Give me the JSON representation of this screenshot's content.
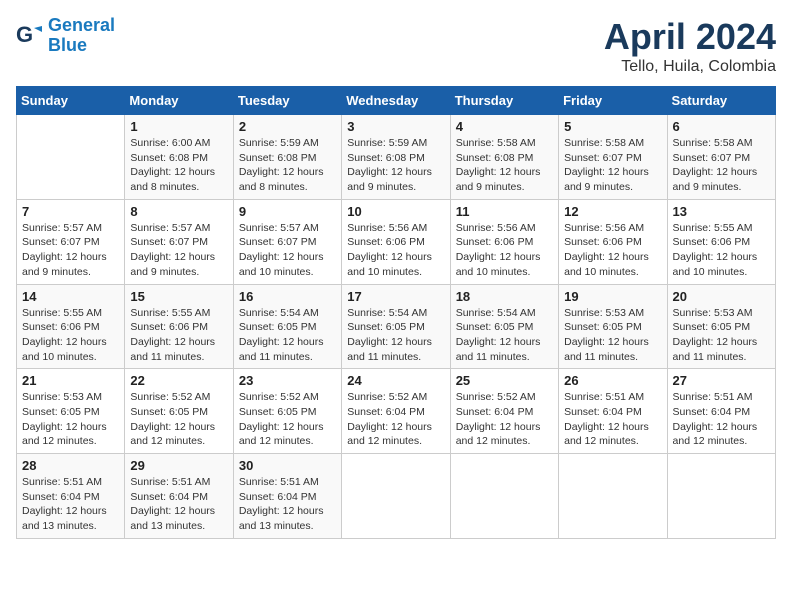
{
  "logo": {
    "line1": "General",
    "line2": "Blue"
  },
  "title": "April 2024",
  "subtitle": "Tello, Huila, Colombia",
  "days_header": [
    "Sunday",
    "Monday",
    "Tuesday",
    "Wednesday",
    "Thursday",
    "Friday",
    "Saturday"
  ],
  "weeks": [
    [
      {
        "day": "",
        "info": ""
      },
      {
        "day": "1",
        "info": "Sunrise: 6:00 AM\nSunset: 6:08 PM\nDaylight: 12 hours\nand 8 minutes."
      },
      {
        "day": "2",
        "info": "Sunrise: 5:59 AM\nSunset: 6:08 PM\nDaylight: 12 hours\nand 8 minutes."
      },
      {
        "day": "3",
        "info": "Sunrise: 5:59 AM\nSunset: 6:08 PM\nDaylight: 12 hours\nand 9 minutes."
      },
      {
        "day": "4",
        "info": "Sunrise: 5:58 AM\nSunset: 6:08 PM\nDaylight: 12 hours\nand 9 minutes."
      },
      {
        "day": "5",
        "info": "Sunrise: 5:58 AM\nSunset: 6:07 PM\nDaylight: 12 hours\nand 9 minutes."
      },
      {
        "day": "6",
        "info": "Sunrise: 5:58 AM\nSunset: 6:07 PM\nDaylight: 12 hours\nand 9 minutes."
      }
    ],
    [
      {
        "day": "7",
        "info": "Sunrise: 5:57 AM\nSunset: 6:07 PM\nDaylight: 12 hours\nand 9 minutes."
      },
      {
        "day": "8",
        "info": "Sunrise: 5:57 AM\nSunset: 6:07 PM\nDaylight: 12 hours\nand 9 minutes."
      },
      {
        "day": "9",
        "info": "Sunrise: 5:57 AM\nSunset: 6:07 PM\nDaylight: 12 hours\nand 10 minutes."
      },
      {
        "day": "10",
        "info": "Sunrise: 5:56 AM\nSunset: 6:06 PM\nDaylight: 12 hours\nand 10 minutes."
      },
      {
        "day": "11",
        "info": "Sunrise: 5:56 AM\nSunset: 6:06 PM\nDaylight: 12 hours\nand 10 minutes."
      },
      {
        "day": "12",
        "info": "Sunrise: 5:56 AM\nSunset: 6:06 PM\nDaylight: 12 hours\nand 10 minutes."
      },
      {
        "day": "13",
        "info": "Sunrise: 5:55 AM\nSunset: 6:06 PM\nDaylight: 12 hours\nand 10 minutes."
      }
    ],
    [
      {
        "day": "14",
        "info": "Sunrise: 5:55 AM\nSunset: 6:06 PM\nDaylight: 12 hours\nand 10 minutes."
      },
      {
        "day": "15",
        "info": "Sunrise: 5:55 AM\nSunset: 6:06 PM\nDaylight: 12 hours\nand 11 minutes."
      },
      {
        "day": "16",
        "info": "Sunrise: 5:54 AM\nSunset: 6:05 PM\nDaylight: 12 hours\nand 11 minutes."
      },
      {
        "day": "17",
        "info": "Sunrise: 5:54 AM\nSunset: 6:05 PM\nDaylight: 12 hours\nand 11 minutes."
      },
      {
        "day": "18",
        "info": "Sunrise: 5:54 AM\nSunset: 6:05 PM\nDaylight: 12 hours\nand 11 minutes."
      },
      {
        "day": "19",
        "info": "Sunrise: 5:53 AM\nSunset: 6:05 PM\nDaylight: 12 hours\nand 11 minutes."
      },
      {
        "day": "20",
        "info": "Sunrise: 5:53 AM\nSunset: 6:05 PM\nDaylight: 12 hours\nand 11 minutes."
      }
    ],
    [
      {
        "day": "21",
        "info": "Sunrise: 5:53 AM\nSunset: 6:05 PM\nDaylight: 12 hours\nand 12 minutes."
      },
      {
        "day": "22",
        "info": "Sunrise: 5:52 AM\nSunset: 6:05 PM\nDaylight: 12 hours\nand 12 minutes."
      },
      {
        "day": "23",
        "info": "Sunrise: 5:52 AM\nSunset: 6:05 PM\nDaylight: 12 hours\nand 12 minutes."
      },
      {
        "day": "24",
        "info": "Sunrise: 5:52 AM\nSunset: 6:04 PM\nDaylight: 12 hours\nand 12 minutes."
      },
      {
        "day": "25",
        "info": "Sunrise: 5:52 AM\nSunset: 6:04 PM\nDaylight: 12 hours\nand 12 minutes."
      },
      {
        "day": "26",
        "info": "Sunrise: 5:51 AM\nSunset: 6:04 PM\nDaylight: 12 hours\nand 12 minutes."
      },
      {
        "day": "27",
        "info": "Sunrise: 5:51 AM\nSunset: 6:04 PM\nDaylight: 12 hours\nand 12 minutes."
      }
    ],
    [
      {
        "day": "28",
        "info": "Sunrise: 5:51 AM\nSunset: 6:04 PM\nDaylight: 12 hours\nand 13 minutes."
      },
      {
        "day": "29",
        "info": "Sunrise: 5:51 AM\nSunset: 6:04 PM\nDaylight: 12 hours\nand 13 minutes."
      },
      {
        "day": "30",
        "info": "Sunrise: 5:51 AM\nSunset: 6:04 PM\nDaylight: 12 hours\nand 13 minutes."
      },
      {
        "day": "",
        "info": ""
      },
      {
        "day": "",
        "info": ""
      },
      {
        "day": "",
        "info": ""
      },
      {
        "day": "",
        "info": ""
      }
    ]
  ]
}
